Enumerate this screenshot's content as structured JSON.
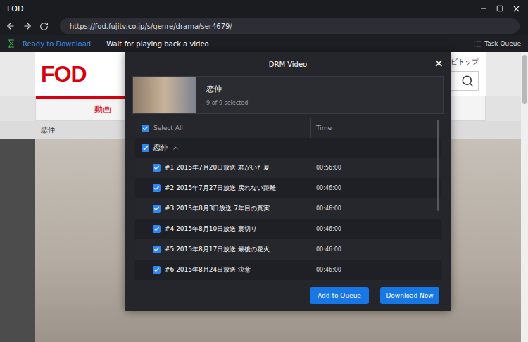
{
  "window": {
    "title": "FOD"
  },
  "address_bar": {
    "url": "https://fod.fujitv.co.jp/s/genre/drama/ser4679/"
  },
  "status_bar": {
    "status": "Ready to Download",
    "message": "Wait for playing back a video",
    "task_queue": "Task Queue"
  },
  "page": {
    "logo": "FOD",
    "top_link": "ビトップ",
    "nav_item": "動画",
    "breadcrumb": "恋仲"
  },
  "dialog": {
    "title": "DRM Video",
    "close": "×",
    "video": {
      "title": "恋仲",
      "selection": "9 of 9 selected"
    },
    "list": {
      "select_all": {
        "label": "Select All",
        "checked": true
      },
      "time_header": "Time",
      "group": {
        "label": "恋仲",
        "checked": true,
        "expanded": true
      },
      "rows": [
        {
          "title": "#1 2015年7月20日放送 君がいた夏",
          "time": "00:56:00",
          "checked": true
        },
        {
          "title": "#2 2015年7月27日放送 戻れない距離",
          "time": "00:46:00",
          "checked": true
        },
        {
          "title": "#3 2015年8月3日放送 7年目の真実",
          "time": "00:46:00",
          "checked": true
        },
        {
          "title": "#4 2015年8月10日放送 裏切り",
          "time": "00:46:00",
          "checked": true
        },
        {
          "title": "#5 2015年8月17日放送 最後の花火",
          "time": "00:46:00",
          "checked": true
        },
        {
          "title": "#6 2015年8月24日放送 決意",
          "time": "00:46:00",
          "checked": true
        }
      ]
    },
    "buttons": [
      "Add to Queue",
      "Download Now"
    ]
  }
}
